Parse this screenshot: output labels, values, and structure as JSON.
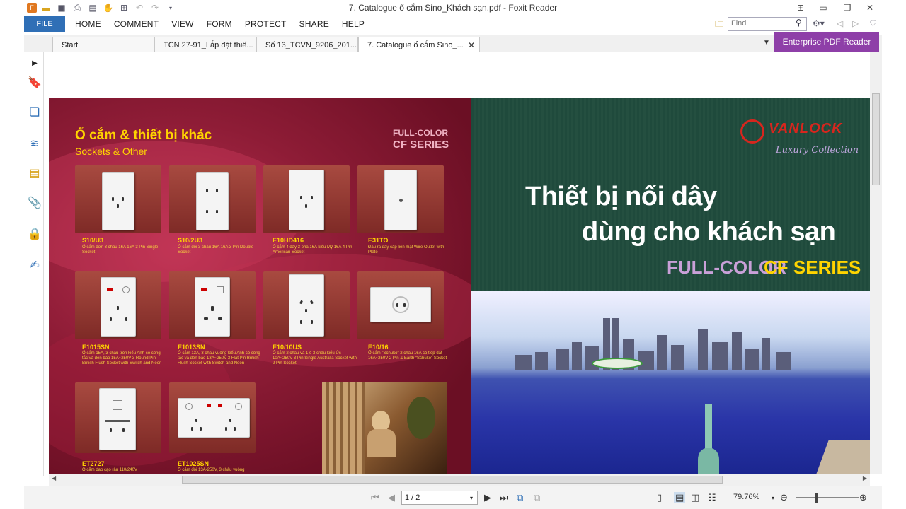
{
  "window": {
    "title": "7. Catalogue ổ cắm Sino_Khách sạn.pdf - Foxit Reader"
  },
  "menu": {
    "file": "FILE",
    "items": [
      "HOME",
      "COMMENT",
      "VIEW",
      "FORM",
      "PROTECT",
      "SHARE",
      "HELP"
    ]
  },
  "search": {
    "placeholder": "Find"
  },
  "tabs": [
    {
      "label": "Start"
    },
    {
      "label": "TCN 27-91_Lắp đặt thiế..."
    },
    {
      "label": "Số 13_TCVN_9206_201..."
    },
    {
      "label": "7. Catalogue ổ cắm Sino_..."
    }
  ],
  "enterprise": "Enterprise PDF Reader",
  "left_page": {
    "title": "Ổ cắm & thiết bị khác",
    "subtitle": "Sockets & Other",
    "badge1": "FULL-COLOR",
    "badge2": "CF SERIES",
    "products": [
      {
        "code": "S10/U3",
        "desc": "Ổ cắm đơn 3 chấu 16A 16A 3 Pin Single Socket"
      },
      {
        "code": "S10/2U3",
        "desc": "Ổ cắm đôi 3 chấu 16A 16A 3 Pin Double Socket"
      },
      {
        "code": "E10HD416",
        "desc": "Ổ cắm 4 dây 3 pha 16A kiểu Mỹ 16A 4 Pin American Socket"
      },
      {
        "code": "E31TO",
        "desc": "Đầu ra dây cáp liền mặt Wire Outlet with Plate"
      },
      {
        "code": "E1015SN",
        "desc": "Ổ cắm 15A, 3 chấu tròn kiểu Anh có công tắc và đèn báo 15A~250V 3 Round Pin British Flush Socket with Switch and Neon"
      },
      {
        "code": "E1013SN",
        "desc": "Ổ cắm 13A, 3 chấu vuông kiểu Anh có công tắc và đèn báo 13A~250V 3 Flat Pin British Flush Socket with Switch and Neon"
      },
      {
        "code": "E10/10US",
        "desc": "Ổ cắm 2 chấu và 1 ổ 3 chấu kiểu Úc 10A~250V 3 Pin Single Australia Socket with 2 Pin Socket"
      },
      {
        "code": "E10/16",
        "desc": "Ổ cắm \"Schuko\" 2 chấu 16A có tiếp đất 16A~250V 2 Pin & Earth \"Schuko\" Socket"
      },
      {
        "code": "ET2727",
        "desc": "Ổ cắm dao cạo râu 110/240V"
      },
      {
        "code": "ET1025SN",
        "desc": "Ổ cắm đôi 13A-250V, 3 chấu vuông"
      }
    ]
  },
  "right_page": {
    "brand": "VANLOCK",
    "collection": "Luxury Collection",
    "headline1": "Thiết bị nối dây",
    "headline2": "dùng cho khách sạn",
    "fc": "FULL-COLOR",
    "cf": "CF SERIES"
  },
  "status": {
    "page": "1 / 2",
    "zoom": "79.76%"
  }
}
